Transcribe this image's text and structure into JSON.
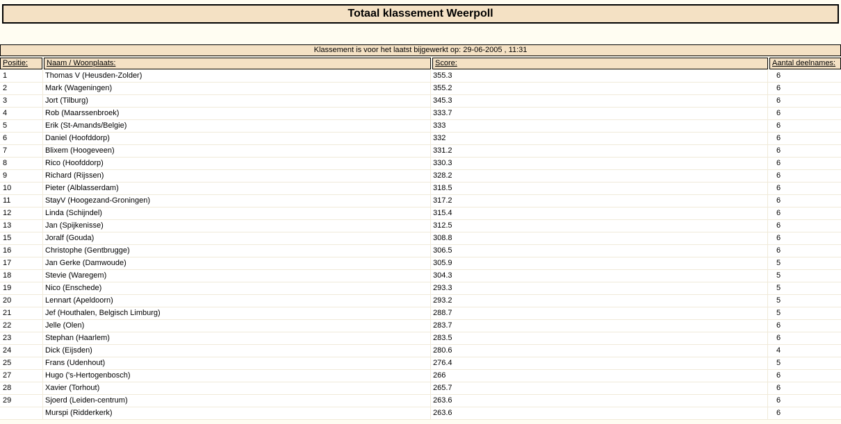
{
  "title": "Totaal klassement Weerpoll",
  "update_notice": "Klassement is voor het laatst bijgewerkt op: 29-06-2005 , 11:31",
  "colors": {
    "bar_background": "#F4E1C4",
    "page_background": "#FFFDF2",
    "border": "#000000",
    "row_background": "#FFFFFF",
    "row_separator": "#F0EAD9"
  },
  "table": {
    "columns": [
      {
        "key": "positie",
        "label": "Positie:"
      },
      {
        "key": "naam",
        "label": "Naam / Woonplaats:"
      },
      {
        "key": "score",
        "label": "Score:"
      },
      {
        "key": "deelnames",
        "label": "Aantal deelnames:"
      }
    ],
    "rows": [
      {
        "positie": "1",
        "naam": "Thomas V (Heusden-Zolder)",
        "score": "355.3",
        "deelnames": "6"
      },
      {
        "positie": "2",
        "naam": "Mark (Wageningen)",
        "score": "355.2",
        "deelnames": "6"
      },
      {
        "positie": "3",
        "naam": "Jort (Tilburg)",
        "score": "345.3",
        "deelnames": "6"
      },
      {
        "positie": "4",
        "naam": "Rob (Maarssenbroek)",
        "score": "333.7",
        "deelnames": "6"
      },
      {
        "positie": "5",
        "naam": "Erik (St-Amands/Belgie)",
        "score": "333",
        "deelnames": "6"
      },
      {
        "positie": "6",
        "naam": "Daniel (Hoofddorp)",
        "score": "332",
        "deelnames": "6"
      },
      {
        "positie": "7",
        "naam": "Blixem (Hoogeveen)",
        "score": "331.2",
        "deelnames": "6"
      },
      {
        "positie": "8",
        "naam": "Rico (Hoofddorp)",
        "score": "330.3",
        "deelnames": "6"
      },
      {
        "positie": "9",
        "naam": "Richard (Rijssen)",
        "score": "328.2",
        "deelnames": "6"
      },
      {
        "positie": "10",
        "naam": "Pieter (Alblasserdam)",
        "score": "318.5",
        "deelnames": "6"
      },
      {
        "positie": "11",
        "naam": "StayV (Hoogezand-Groningen)",
        "score": "317.2",
        "deelnames": "6"
      },
      {
        "positie": "12",
        "naam": "Linda (Schijndel)",
        "score": "315.4",
        "deelnames": "6"
      },
      {
        "positie": "13",
        "naam": "Jan (Spijkenisse)",
        "score": "312.5",
        "deelnames": "6"
      },
      {
        "positie": "15",
        "naam": "Joralf (Gouda)",
        "score": "308.8",
        "deelnames": "6"
      },
      {
        "positie": "16",
        "naam": "Christophe (Gentbrugge)",
        "score": "306.5",
        "deelnames": "6"
      },
      {
        "positie": "17",
        "naam": "Jan Gerke (Damwoude)",
        "score": "305.9",
        "deelnames": "5"
      },
      {
        "positie": "18",
        "naam": "Stevie (Waregem)",
        "score": "304.3",
        "deelnames": "5"
      },
      {
        "positie": "19",
        "naam": "Nico (Enschede)",
        "score": "293.3",
        "deelnames": "5"
      },
      {
        "positie": "20",
        "naam": "Lennart (Apeldoorn)",
        "score": "293.2",
        "deelnames": "5"
      },
      {
        "positie": "21",
        "naam": "Jef (Houthalen, Belgisch Limburg)",
        "score": "288.7",
        "deelnames": "5"
      },
      {
        "positie": "22",
        "naam": "Jelle (Olen)",
        "score": "283.7",
        "deelnames": "6"
      },
      {
        "positie": "23",
        "naam": "Stephan (Haarlem)",
        "score": "283.5",
        "deelnames": "6"
      },
      {
        "positie": "24",
        "naam": "Dick (Eijsden)",
        "score": "280.6",
        "deelnames": "4"
      },
      {
        "positie": "25",
        "naam": "Frans (Udenhout)",
        "score": "276.4",
        "deelnames": "5"
      },
      {
        "positie": "27",
        "naam": "Hugo ('s-Hertogenbosch)",
        "score": "266",
        "deelnames": "6"
      },
      {
        "positie": "28",
        "naam": "Xavier (Torhout)",
        "score": "265.7",
        "deelnames": "6"
      },
      {
        "positie": "29",
        "naam": "Sjoerd (Leiden-centrum)",
        "score": "263.6",
        "deelnames": "6"
      },
      {
        "positie": "",
        "naam": "Murspi (Ridderkerk)",
        "score": "263.6",
        "deelnames": "6"
      }
    ]
  }
}
